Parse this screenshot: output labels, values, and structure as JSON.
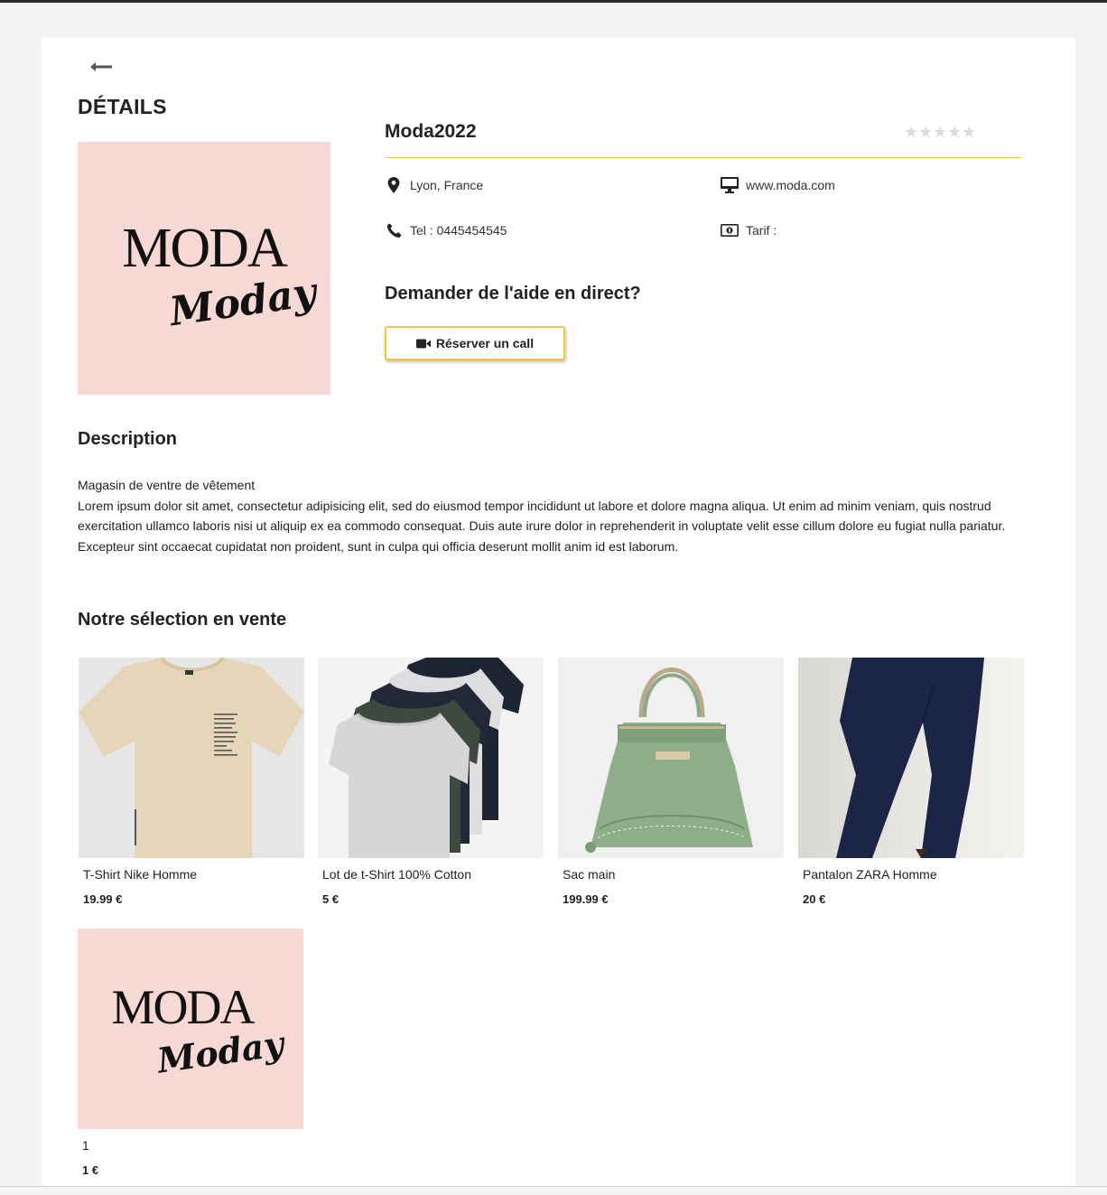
{
  "page": {
    "title": "DÉTAILS",
    "back_icon": "arrow-left-icon"
  },
  "shop": {
    "name": "Moda2022",
    "rating_stars": 0,
    "rating_max": 5,
    "logo": {
      "line1": "MODA",
      "line2": "Moday"
    },
    "location": {
      "icon": "map-pin-icon",
      "text": "Lyon, France"
    },
    "website": {
      "icon": "monitor-icon",
      "text": "www.moda.com"
    },
    "phone": {
      "icon": "phone-icon",
      "text": "Tel : 0445454545"
    },
    "tarif": {
      "icon": "money-bill-icon",
      "text": "Tarif :"
    }
  },
  "help": {
    "title": "Demander de l'aide en direct?",
    "button_label": "Réserver un call",
    "button_icon": "video-camera-icon"
  },
  "description": {
    "title": "Description",
    "subtitle": "Magasin de ventre de vêtement",
    "body": "Lorem ipsum dolor sit amet, consectetur adipisicing elit, sed do eiusmod tempor incididunt ut labore et dolore magna aliqua. Ut enim ad minim veniam, quis nostrud exercitation ullamco laboris nisi ut aliquip ex ea commodo consequat. Duis aute irure dolor in reprehenderit in voluptate velit esse cillum dolore eu fugiat nulla pariatur. Excepteur sint occaecat cupidatat non proident, sunt in culpa qui officia deserunt mollit anim id est laborum."
  },
  "selection": {
    "title": "Notre sélection en vente",
    "products": [
      {
        "name": "T-Shirt  Nike Homme",
        "price": "19.99 €",
        "image": "beige-tshirt"
      },
      {
        "name": "Lot de t-Shirt 100% Cotton",
        "price": "5 €",
        "image": "tshirt-stack"
      },
      {
        "name": "Sac main",
        "price": "199.99 €",
        "image": "green-handbag"
      },
      {
        "name": "Pantalon ZARA Homme",
        "price": "20 €",
        "image": "navy-pants"
      },
      {
        "name": "1",
        "price": "1 €",
        "image": "moda-logo"
      }
    ]
  },
  "colors": {
    "accent": "#f0c63d",
    "logo_background": "#f6d8d5",
    "page_background": "#f4f4f4",
    "star_empty": "#dcdcdc"
  }
}
